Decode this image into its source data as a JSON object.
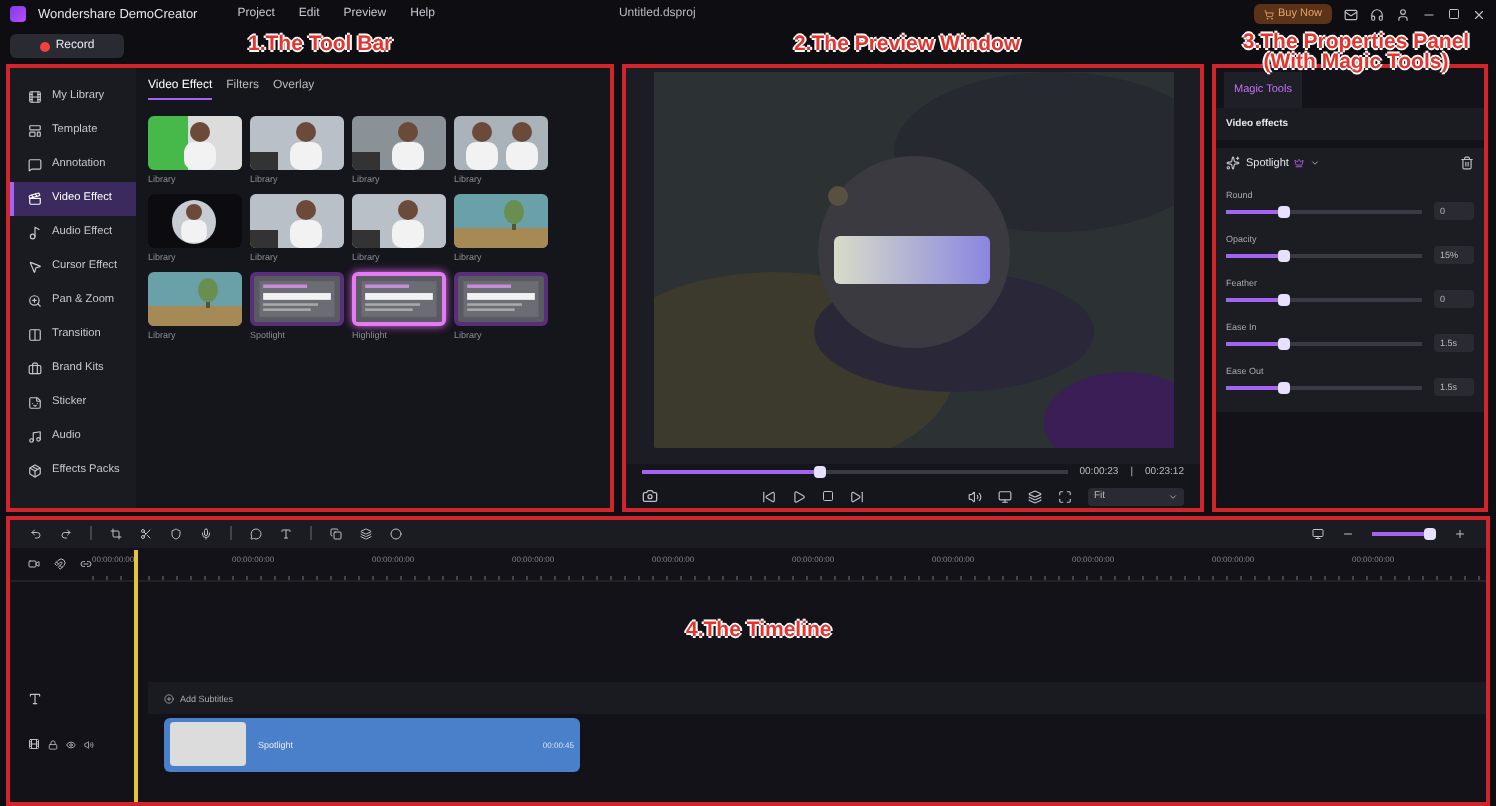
{
  "app": {
    "name": "Wondershare DemoCreator",
    "menu": [
      "Project",
      "Edit",
      "Preview",
      "Help"
    ],
    "file_name": "Untitled.dsproj",
    "buy_button": "Buy Now",
    "record_button": "Record"
  },
  "annotations": [
    "1.The Tool Bar",
    "2.The Preview Window",
    "3.The Properties Panel (With Magic Tools)",
    "4.The Timeline"
  ],
  "sidebar": [
    {
      "label": "My Library",
      "selected": false
    },
    {
      "label": "Template",
      "selected": false
    },
    {
      "label": "Annotation",
      "selected": false
    },
    {
      "label": "Video Effect",
      "selected": true
    },
    {
      "label": "Audio Effect",
      "selected": false
    },
    {
      "label": "Cursor Effect",
      "selected": false
    },
    {
      "label": "Pan & Zoom",
      "selected": false
    },
    {
      "label": "Transition",
      "selected": false
    },
    {
      "label": "Brand Kits",
      "selected": false
    },
    {
      "label": "Sticker",
      "selected": false
    },
    {
      "label": "Audio",
      "selected": false
    },
    {
      "label": "Effects Packs",
      "selected": false
    }
  ],
  "library": {
    "tabs": [
      {
        "label": "Video Effect",
        "selected": true
      },
      {
        "label": "Filters",
        "selected": false
      },
      {
        "label": "Overlay",
        "selected": false
      }
    ],
    "items": [
      {
        "caption": "Library",
        "kind": "green",
        "selected": false
      },
      {
        "caption": "Library",
        "kind": "person",
        "selected": false
      },
      {
        "caption": "Library",
        "kind": "blur",
        "selected": false
      },
      {
        "caption": "Library",
        "kind": "duo",
        "selected": false
      },
      {
        "caption": "Library",
        "kind": "round",
        "selected": false
      },
      {
        "caption": "Library",
        "kind": "person",
        "selected": false
      },
      {
        "caption": "Library",
        "kind": "person",
        "selected": false
      },
      {
        "caption": "Library",
        "kind": "landscape",
        "selected": false
      },
      {
        "caption": "Library",
        "kind": "landscape",
        "selected": false
      },
      {
        "caption": "Spotlight",
        "kind": "document",
        "selected": false
      },
      {
        "caption": "Highlight",
        "kind": "document",
        "selected": true
      },
      {
        "caption": "Library",
        "kind": "document",
        "selected": false
      }
    ]
  },
  "preview": {
    "progress": {
      "level": 0.42
    },
    "current_time": "00:00:23",
    "time_separator": "|",
    "total_time": "00:23:12",
    "zoom": "Fit"
  },
  "properties": {
    "tab": "Magic Tools",
    "section": "Video effects",
    "effect": "Spotlight",
    "params": [
      {
        "label": "Round",
        "level": 0.3,
        "value": "0"
      },
      {
        "label": "Opacity",
        "level": 0.3,
        "value": "15%"
      },
      {
        "label": "Feather",
        "level": 0.3,
        "value": "0"
      },
      {
        "label": "Ease In",
        "level": 0.3,
        "value": "1.5s"
      },
      {
        "label": "Ease Out",
        "level": 0.3,
        "value": "1.5s"
      }
    ]
  },
  "timeline": {
    "ruler": [
      "00:00:00:00",
      "00:00:00:00",
      "00:00:00:00",
      "00:00:00:00",
      "00:00:00:00",
      "00:00:00:00",
      "00:00:00:00",
      "00:00:00:00",
      "00:00:00:00",
      "00:00:00:00"
    ],
    "zoom": {
      "level": 0.92
    },
    "subtitle_button": "Add Subtitles",
    "clip": {
      "label": "Spotlight",
      "duration": "00:00:45"
    }
  }
}
